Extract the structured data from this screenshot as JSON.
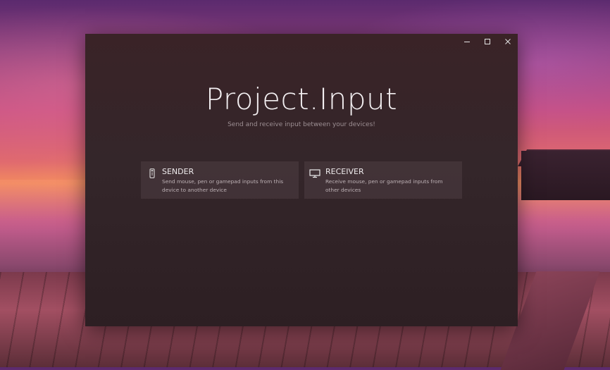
{
  "app": {
    "title": "Project.Input",
    "subtitle": "Send and receive input between your devices!"
  },
  "window_controls": {
    "minimize": "minimize",
    "maximize": "maximize",
    "close": "close"
  },
  "cards": [
    {
      "title": "SENDER",
      "description": "Send mouse, pen or gamepad inputs from this device to another device",
      "icon": "remote-icon"
    },
    {
      "title": "RECEIVER",
      "description": "Receive mouse, pen or gamepad inputs from other devices",
      "icon": "monitor-icon"
    }
  ]
}
